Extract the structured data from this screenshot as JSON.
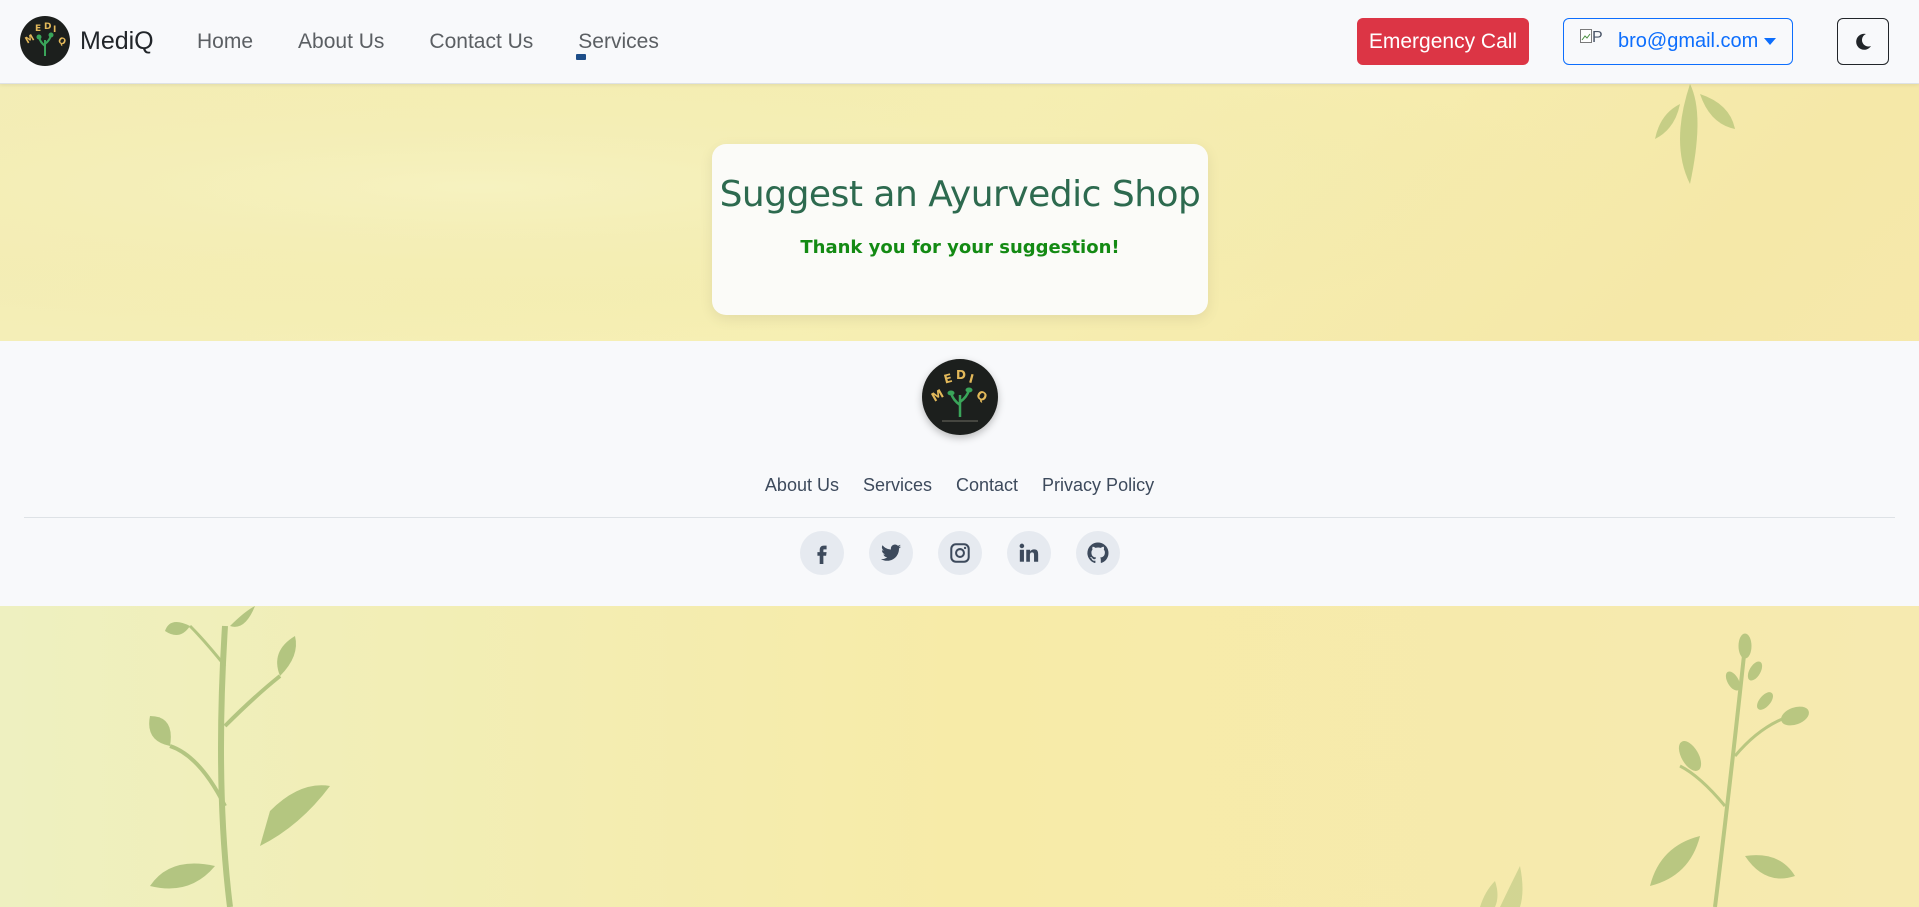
{
  "navbar": {
    "brand": "MediQ",
    "links": [
      {
        "label": "Home"
      },
      {
        "label": "About Us"
      },
      {
        "label": "Contact Us"
      },
      {
        "label": "Services"
      }
    ],
    "emergency_label": "Emergency Call",
    "user": {
      "avatar_alt": "P",
      "email": "bro@gmail.com"
    },
    "theme_icon": "moon-icon"
  },
  "card": {
    "title": "Suggest an Ayurvedic Shop",
    "message": "Thank you for your suggestion!"
  },
  "footer": {
    "links": [
      {
        "label": "About Us"
      },
      {
        "label": "Services"
      },
      {
        "label": "Contact"
      },
      {
        "label": "Privacy Policy"
      }
    ],
    "socials": [
      "facebook-icon",
      "twitter-icon",
      "instagram-icon",
      "linkedin-icon",
      "github-icon"
    ]
  },
  "colors": {
    "accent": "#0d6efd",
    "danger": "#dc3545",
    "title_green": "#2d6a4f",
    "success_green": "#138a13"
  }
}
